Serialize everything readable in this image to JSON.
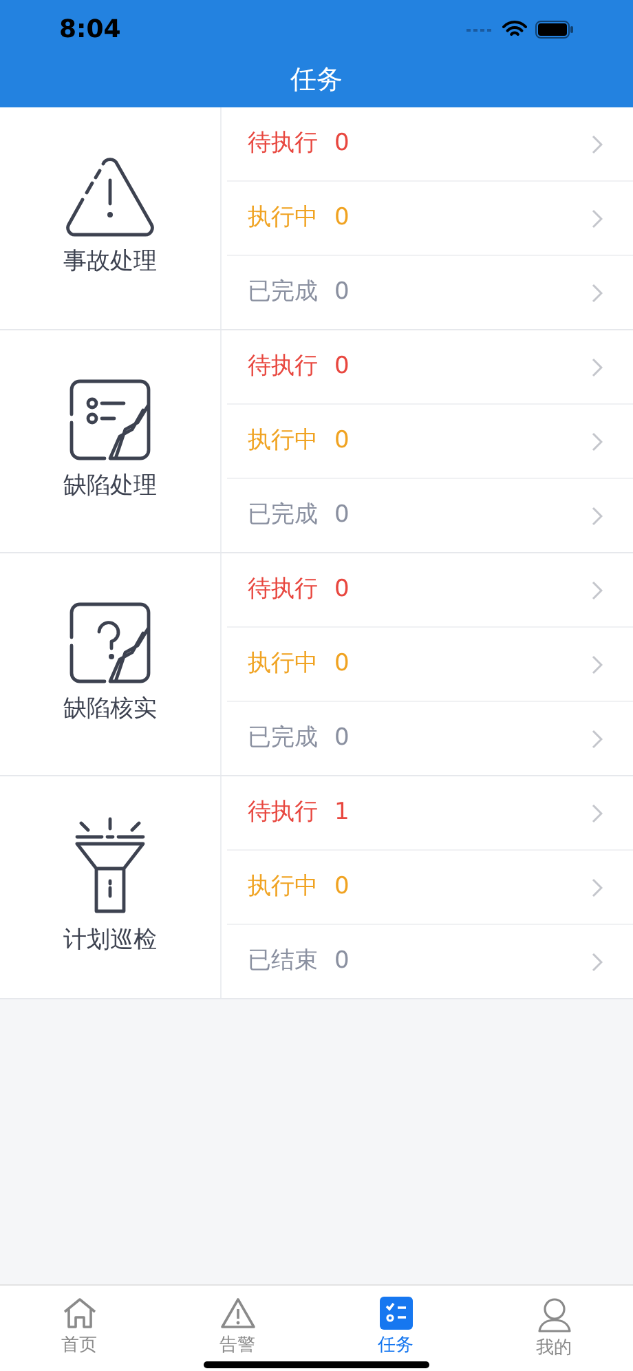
{
  "status_bar": {
    "time": "8:04"
  },
  "title": "任务",
  "sections": [
    {
      "kind": "accident",
      "label": "事故处理",
      "rows": [
        {
          "kind": "pending",
          "label": "待执行",
          "count": "0"
        },
        {
          "kind": "running",
          "label": "执行中",
          "count": "0"
        },
        {
          "kind": "done",
          "label": "已完成",
          "count": "0"
        }
      ]
    },
    {
      "kind": "defect",
      "label": "缺陷处理",
      "rows": [
        {
          "kind": "pending",
          "label": "待执行",
          "count": "0"
        },
        {
          "kind": "running",
          "label": "执行中",
          "count": "0"
        },
        {
          "kind": "done",
          "label": "已完成",
          "count": "0"
        }
      ]
    },
    {
      "kind": "verify",
      "label": "缺陷核实",
      "rows": [
        {
          "kind": "pending",
          "label": "待执行",
          "count": "0"
        },
        {
          "kind": "running",
          "label": "执行中",
          "count": "0"
        },
        {
          "kind": "done",
          "label": "已完成",
          "count": "0"
        }
      ]
    },
    {
      "kind": "inspection",
      "label": "计划巡检",
      "rows": [
        {
          "kind": "pending",
          "label": "待执行",
          "count": "1"
        },
        {
          "kind": "running",
          "label": "执行中",
          "count": "0"
        },
        {
          "kind": "done",
          "label": "已结束",
          "count": "0"
        }
      ]
    }
  ],
  "tab_bar": [
    {
      "kind": "home",
      "label": "首页",
      "selected": false
    },
    {
      "kind": "alarm",
      "label": "告警",
      "selected": false
    },
    {
      "kind": "tasks",
      "label": "任务",
      "selected": true
    },
    {
      "kind": "me",
      "label": "我的",
      "selected": false
    }
  ]
}
